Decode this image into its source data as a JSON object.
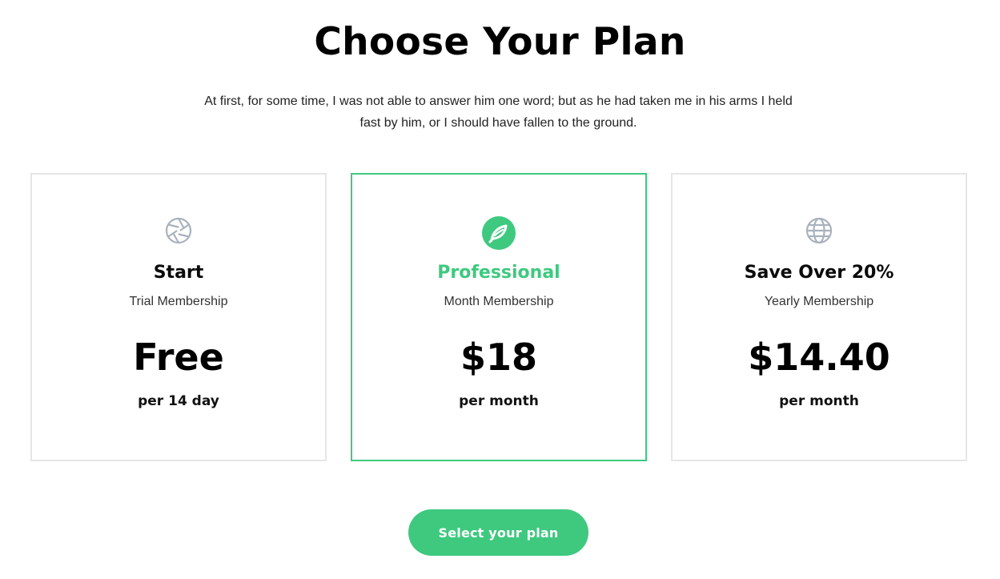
{
  "header": {
    "title": "Choose Your Plan",
    "intro_line1": "At first, for some time, I was not able to answer him one word; but as he had taken me in his arms I held",
    "intro_line2": "fast by him, or I should have fallen to the ground."
  },
  "plans": [
    {
      "icon": "aperture-icon",
      "name": "Start",
      "membership": "Trial Membership",
      "price": "Free",
      "period": "per 14 day",
      "featured": false
    },
    {
      "icon": "leaf-badge-icon",
      "name": "Professional",
      "membership": "Month Membership",
      "price": "$18",
      "period": "per month",
      "featured": true
    },
    {
      "icon": "globe-icon",
      "name": "Save Over 20%",
      "membership": "Yearly Membership",
      "price": "$14.40",
      "period": "per month",
      "featured": false
    }
  ],
  "cta": {
    "label": "Select your plan"
  },
  "colors": {
    "accent": "#3ec97f",
    "card_border": "#e6e6e6",
    "icon_gray": "#a9b2bd",
    "text_dark": "#0a0a0a"
  }
}
